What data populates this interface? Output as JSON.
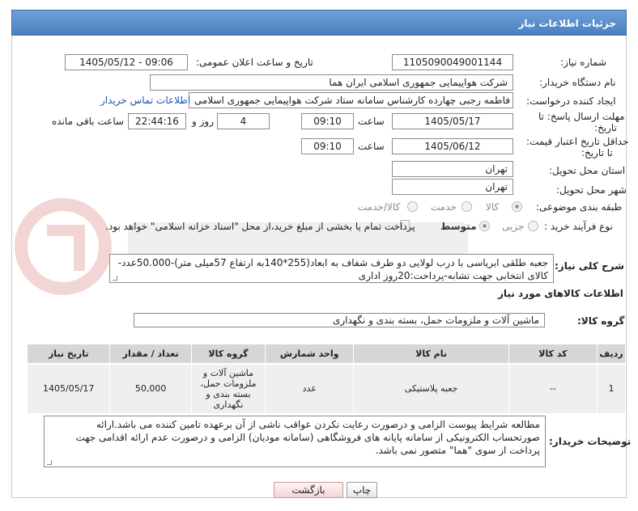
{
  "header": {
    "title": "جزئیات اطلاعات نیاز"
  },
  "fields": {
    "need_number_label": "شماره نیاز:",
    "need_number": "1105090049001144",
    "announce_label": "تاریخ و ساعت اعلان عمومی:",
    "announce_value": "1405/05/12 - 09:06",
    "buyer_label": "نام دستگاه خریدار:",
    "buyer_value": "شرکت هواپیمایی جمهوری اسلامی ایران هما",
    "creator_label": "ایجاد کننده درخواست:",
    "creator_value": "فاطمه رجبی چهارده کارشناس سامانه ستاد شرکت هواپیمایی جمهوری اسلامی",
    "contact_link": "اطلاعات تماس خریدار",
    "reply_label_1": "مهلت ارسال پاسخ: تا",
    "reply_label_2": "تاریخ:",
    "reply_date": "1405/05/17",
    "time_label": "ساعت",
    "reply_time": "09:10",
    "days_value": "4",
    "days_label": "روز و",
    "remaining_time": "22:44:16",
    "remaining_label": "ساعت باقی مانده",
    "price_label_1": "حداقل تاریخ اعتبار قیمت:",
    "price_label_2": "تا تاریخ:",
    "price_date": "1405/06/12",
    "price_time": "09:10",
    "province_label": "استان محل تحویل:",
    "province_value": "تهران",
    "city_label": "شهر محل تحویل:",
    "city_value": "تهران",
    "category_label": "طبقه بندی موضوعی:",
    "category_options": [
      "کالا",
      "خدمت",
      "کالا/خدمت"
    ],
    "process_label": "نوع فرآیند خرید :",
    "process_options": [
      "جزیی",
      "متوسط"
    ],
    "treasury_text": "پرداخت تمام یا بخشی از مبلغ خرید،از محل \"اسناد خزانه اسلامی\" خواهد بود."
  },
  "description": {
    "label": "شرح کلی نیاز:",
    "text": "جعبه طلقی ابریاسی با درب لولایی دو طرف شفاف به ابعاد(255*140به ارتفاع 57میلی متر)-50.000عدد-کالای انتخابی جهت تشابه-پرداخت:20روز اداری"
  },
  "goods": {
    "section_title": "اطلاعات کالاهای مورد نیاز",
    "group_label": "گروه کالا:",
    "group_value": "ماشین آلات و ملزومات حمل، بسته بندی و نگهداری"
  },
  "table": {
    "headers": [
      "ردیف",
      "کد کالا",
      "نام کالا",
      "واحد شمارش",
      "گروه کالا",
      "تعداد / مقدار",
      "تاریخ نیاز"
    ],
    "rows": [
      [
        "1",
        "--",
        "جعبه پلاستیکی",
        "عدد",
        "ماشین آلات و ملزومات حمل، بسته بندی و نگهداری",
        "50,000",
        "1405/05/17"
      ]
    ]
  },
  "buyer_notes": {
    "label": "توضیحات خریدار:",
    "text": "مطالعه شرایط پیوست الزامی و درصورت رعایت نکردن عواقب ناشی از آن برعهده تامین کننده می باشد.ارائه صورتحساب الکترونیکی از سامانه پایانه های فروشگاهی (سامانه مودیان) الزامی و درصورت عدم ارائه اقدامی جهت پرداخت از سوی \"هما\" متصور نمی باشد."
  },
  "buttons": {
    "print": "چاپ",
    "back": "بازگشت"
  },
  "colors": {
    "header_bg": "#4a80c2",
    "link": "#1a56b0"
  }
}
